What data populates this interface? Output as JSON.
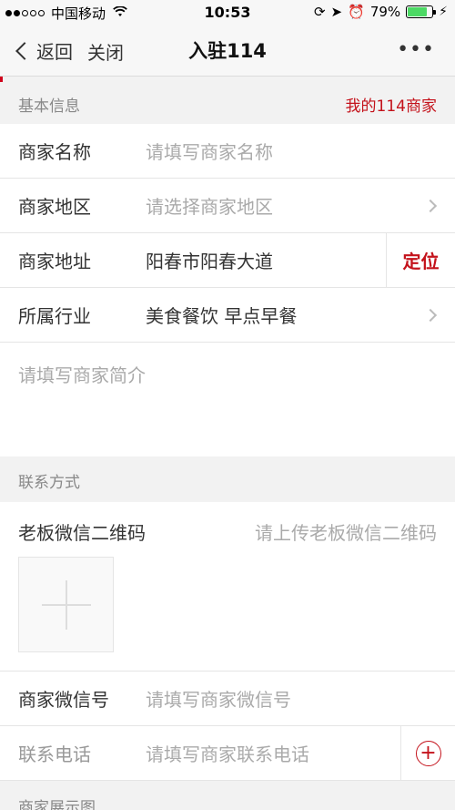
{
  "status_bar": {
    "carrier": "中国移动",
    "time": "10:53",
    "battery": "79%",
    "battery_level": 0.79
  },
  "nav": {
    "back_label": "返回",
    "close_label": "关闭",
    "title": "入驻114",
    "more": "•••"
  },
  "basic": {
    "header": "基本信息",
    "link": "我的114商家",
    "name_label": "商家名称",
    "name_placeholder": "请填写商家名称",
    "region_label": "商家地区",
    "region_placeholder": "请选择商家地区",
    "address_label": "商家地址",
    "address_value": "阳春市阳春大道",
    "locate": "定位",
    "industry_label": "所属行业",
    "industry_value": "美食餐饮 早点早餐",
    "intro_placeholder": "请填写商家简介"
  },
  "contact": {
    "header": "联系方式",
    "qr_label": "老板微信二维码",
    "qr_hint": "请上传老板微信二维码",
    "wechat_label": "商家微信号",
    "wechat_placeholder": "请填写商家微信号",
    "phone_label": "联系电话",
    "phone_placeholder": "请填写商家联系电话"
  },
  "display": {
    "header": "商家展示图"
  }
}
